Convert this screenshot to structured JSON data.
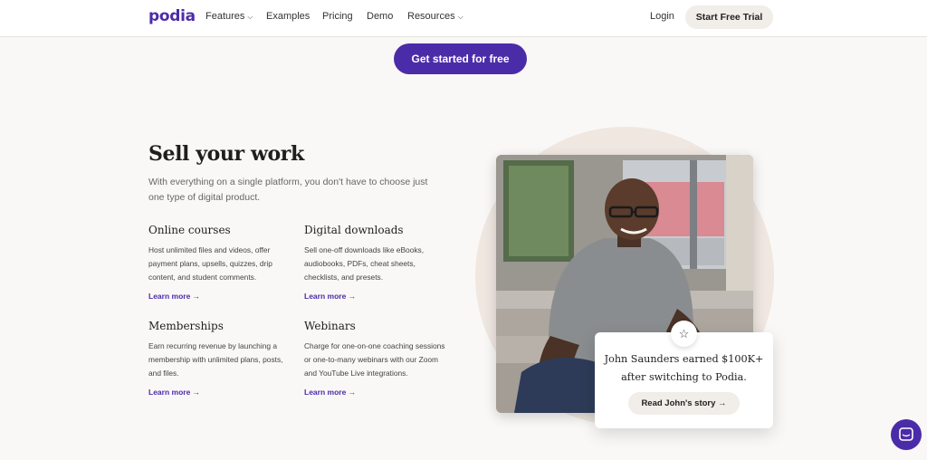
{
  "nav": {
    "logo": "podia",
    "links": [
      {
        "label": "Features",
        "dropdown": true
      },
      {
        "label": "Examples",
        "dropdown": false
      },
      {
        "label": "Pricing",
        "dropdown": false
      },
      {
        "label": "Demo",
        "dropdown": false
      },
      {
        "label": "Resources",
        "dropdown": true
      }
    ],
    "login": "Login",
    "trial": "Start Free Trial"
  },
  "cta": {
    "label": "Get started for free"
  },
  "section": {
    "title": "Sell your work",
    "subtitle": "With everything on a single platform, you don't have to choose just one type of digital product.",
    "features": [
      {
        "title": "Online courses",
        "text": "Host unlimited files and videos, offer payment plans, upsells, quizzes, drip content, and student comments.",
        "link": "Learn more →"
      },
      {
        "title": "Digital downloads",
        "text": "Sell one-off downloads like eBooks, audiobooks, PDFs, cheat sheets, checklists, and presets.",
        "link": "Learn more →"
      },
      {
        "title": "Memberships",
        "text": "Earn recurring revenue by launching a membership with unlimited plans, posts, and files.",
        "link": "Learn more →"
      },
      {
        "title": "Webinars",
        "text": "Charge for one-on-one coaching sessions or one-to-many webinars with our Zoom and YouTube Live integrations.",
        "link": "Learn more →"
      }
    ]
  },
  "testimonial": {
    "line1": "John Saunders earned $100K+",
    "line2": "after switching to Podia.",
    "button": "Read John's story →",
    "star_icon": "star-icon"
  },
  "colors": {
    "brand": "#4b2ca8",
    "background": "#faf8f6",
    "pill": "#f1ede8"
  }
}
